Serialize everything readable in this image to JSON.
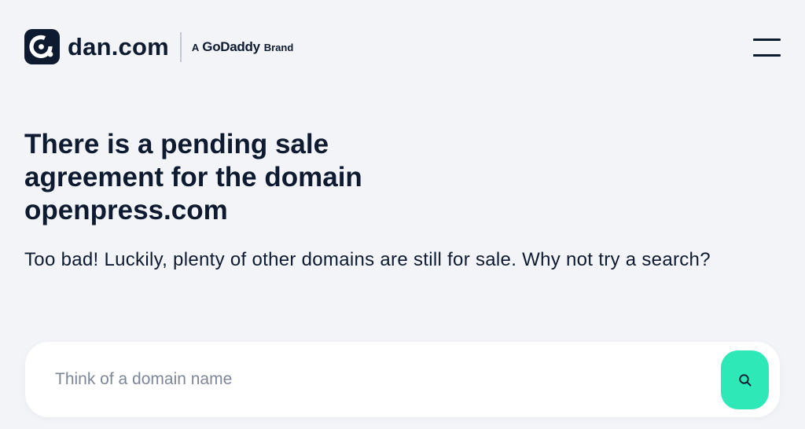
{
  "header": {
    "logo_text": "dan.com",
    "brand_prefix": "A",
    "brand_name": "GoDaddy",
    "brand_suffix": "Brand",
    "menu_icon": "hamburger-menu-icon"
  },
  "main": {
    "headline": "There is a pending sale agreement for the domain openpress.com",
    "subtext": "Too bad! Luckily, plenty of other domains are still for sale. Why not try a search?"
  },
  "search": {
    "placeholder": "Think of a domain name",
    "value": "",
    "button_icon": "search-icon",
    "button_color": "#2ee8b7"
  },
  "colors": {
    "background": "#f2f4f7",
    "text": "#0d1a30",
    "accent": "#2ee8b7"
  }
}
